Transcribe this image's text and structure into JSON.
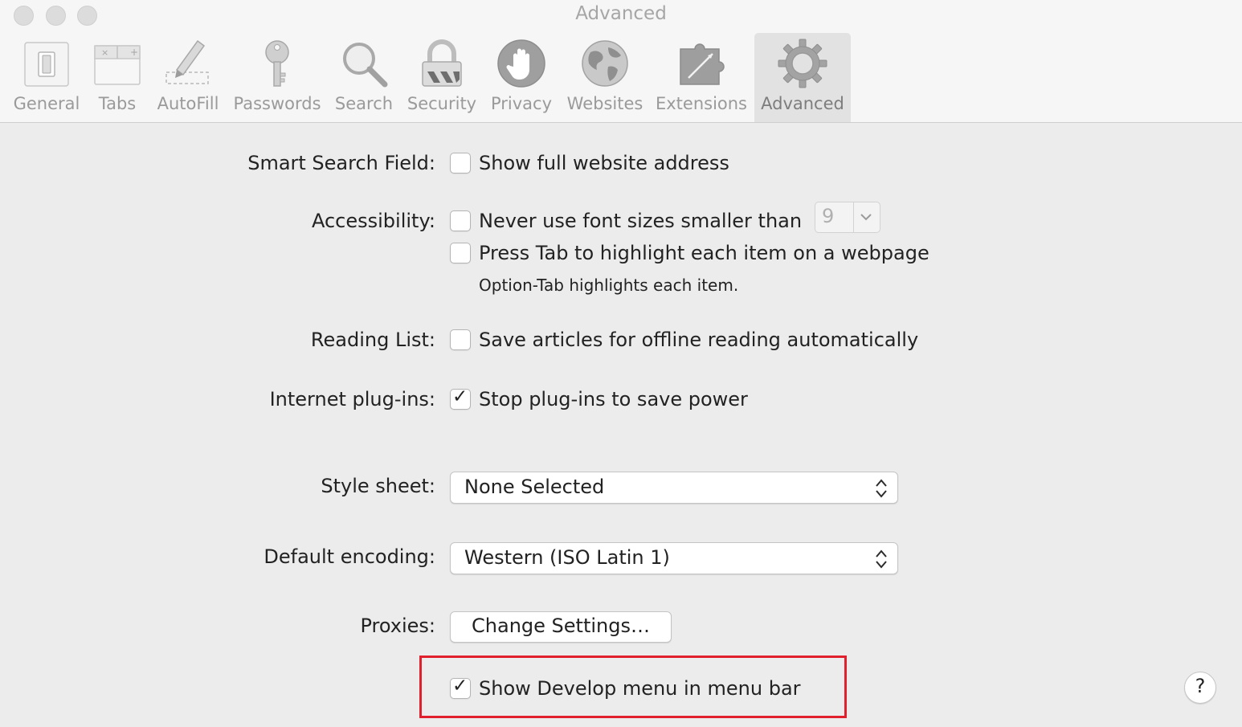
{
  "window": {
    "title": "Advanced"
  },
  "toolbar": {
    "items": [
      {
        "label": "General",
        "icon": "general-switch-icon"
      },
      {
        "label": "Tabs",
        "icon": "tabs-icon"
      },
      {
        "label": "AutoFill",
        "icon": "autofill-pencil-icon"
      },
      {
        "label": "Passwords",
        "icon": "key-icon"
      },
      {
        "label": "Search",
        "icon": "magnifier-icon"
      },
      {
        "label": "Security",
        "icon": "padlock-icon"
      },
      {
        "label": "Privacy",
        "icon": "hand-icon"
      },
      {
        "label": "Websites",
        "icon": "globe-icon"
      },
      {
        "label": "Extensions",
        "icon": "puzzle-piece-icon"
      },
      {
        "label": "Advanced",
        "icon": "gear-icon",
        "selected": true
      }
    ]
  },
  "settings": {
    "smart_search": {
      "label": "Smart Search Field:",
      "option": "Show full website address",
      "checked": false
    },
    "accessibility": {
      "label": "Accessibility:",
      "font_option": "Never use font sizes smaller than",
      "font_checked": false,
      "font_size": "9",
      "tab_option": "Press Tab to highlight each item on a webpage",
      "tab_checked": false,
      "tab_hint": "Option-Tab highlights each item."
    },
    "reading_list": {
      "label": "Reading List:",
      "option": "Save articles for offline reading automatically",
      "checked": false
    },
    "plugins": {
      "label": "Internet plug-ins:",
      "option": "Stop plug-ins to save power",
      "checked": true
    },
    "style_sheet": {
      "label": "Style sheet:",
      "value": "None Selected"
    },
    "encoding": {
      "label": "Default encoding:",
      "value": "Western (ISO Latin 1)"
    },
    "proxies": {
      "label": "Proxies:",
      "button": "Change Settings…"
    },
    "develop": {
      "option": "Show Develop menu in menu bar",
      "checked": true
    }
  },
  "help": {
    "label": "?"
  },
  "colors": {
    "highlight_border": "#e0202c",
    "window_bg": "#ececec",
    "toolbar_bg": "#f6f6f6"
  }
}
